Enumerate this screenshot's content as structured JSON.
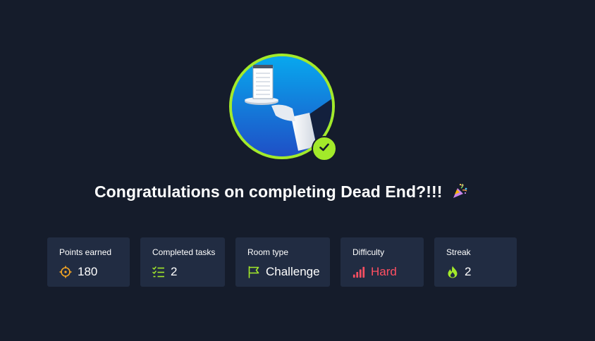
{
  "headline": {
    "text": "Congratulations on completing Dead End?!!!",
    "emoji_icon": "party-popper-icon"
  },
  "room_avatar": {
    "description_icon": "waiter-tray-notepad-icon",
    "completed_badge_icon": "check-icon"
  },
  "stats": [
    {
      "label": "Points earned",
      "value": "180",
      "icon": "crosshair-icon",
      "icon_color": "#f5a623"
    },
    {
      "label": "Completed tasks",
      "value": "2",
      "icon": "task-list-icon",
      "icon_color": "#a3ea2a"
    },
    {
      "label": "Room type",
      "value": "Challenge",
      "icon": "flag-icon",
      "icon_color": "#a3ea2a"
    },
    {
      "label": "Difficulty",
      "value": "Hard",
      "icon": "signal-bars-icon",
      "icon_color": "#ff4f62"
    },
    {
      "label": "Streak",
      "value": "2",
      "icon": "flame-icon",
      "icon_color": "#a3ea2a"
    }
  ],
  "colors": {
    "background": "#151c2b",
    "card": "#212c42",
    "accent": "#a3ea2a",
    "hard": "#ff4f62"
  }
}
